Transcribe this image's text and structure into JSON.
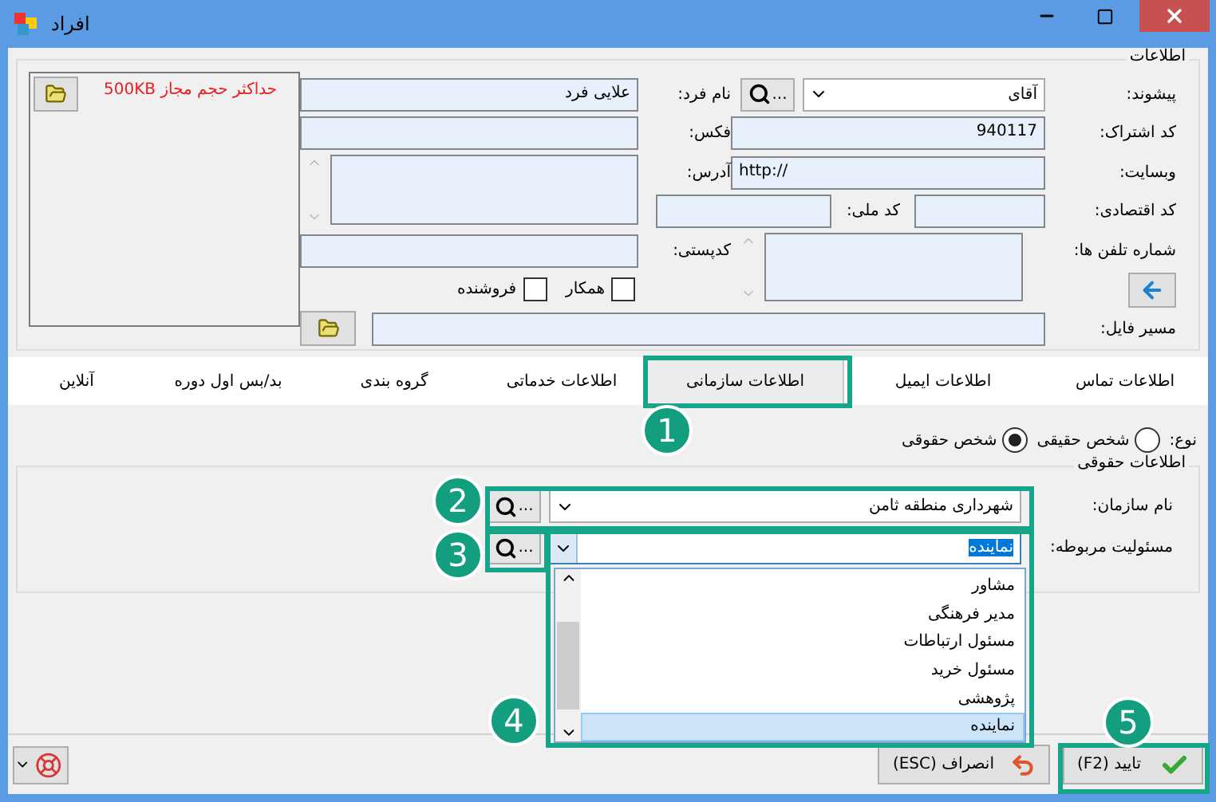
{
  "window": {
    "title": "افراد"
  },
  "info_group": {
    "title": "اطلاعات",
    "image_note": "حداکثر حجم مجاز 500KB",
    "prefix": {
      "label": "پیشوند:",
      "value": "آقای",
      "more": "..."
    },
    "person_name": {
      "label": "نام فرد:",
      "value": "علایی فرد"
    },
    "subscription_code": {
      "label": "کد اشتراک:",
      "value": "940117"
    },
    "fax": {
      "label": "فکس:"
    },
    "website": {
      "label": "وبسایت:",
      "value": "http://"
    },
    "address": {
      "label": "آدرس:"
    },
    "economic_code": {
      "label": "کد اقتصادی:"
    },
    "national_code": {
      "label": "کد ملی:"
    },
    "phones": {
      "label": "شماره تلفن ها:"
    },
    "postal_code": {
      "label": "کدپستی:"
    },
    "checkboxes": [
      {
        "label": "همکار",
        "checked": false
      },
      {
        "label": "فروشنده",
        "checked": false
      }
    ],
    "file_path": {
      "label": "مسیر فایل:"
    }
  },
  "tabs": [
    {
      "label": "اطلاعات تماس",
      "selected": false
    },
    {
      "label": "اطلاعات ایمیل",
      "selected": false
    },
    {
      "label": "اطلاعات سازمانی",
      "selected": true
    },
    {
      "label": "اطلاعات خدماتی",
      "selected": false
    },
    {
      "label": "گروه بندی",
      "selected": false
    },
    {
      "label": "بد/بس اول دوره",
      "selected": false
    },
    {
      "label": "آنلاین",
      "selected": false
    }
  ],
  "type_row": {
    "label": "نوع:",
    "options": [
      {
        "label": "شخص حقیقی",
        "selected": false
      },
      {
        "label": "شخص حقوقی",
        "selected": true
      }
    ]
  },
  "legal_group": {
    "title": "اطلاعات حقوقی",
    "organization": {
      "label": "نام سازمان:",
      "value": "شهرداری منطقه ثامن",
      "more": "..."
    },
    "responsibility": {
      "label": "مسئولیت مربوطه:",
      "value": "نماینده",
      "more": "..."
    },
    "dropdown": [
      {
        "label": "مشاور",
        "selected": false
      },
      {
        "label": "مدیر فرهنگی",
        "selected": false
      },
      {
        "label": "مسئول ارتباطات",
        "selected": false
      },
      {
        "label": "مسئول خرید",
        "selected": false
      },
      {
        "label": "پژوهشی",
        "selected": false
      },
      {
        "label": "نماینده",
        "selected": true
      }
    ]
  },
  "buttons": [
    {
      "kind": "ok",
      "label": "تایید (F2)"
    },
    {
      "kind": "cancel",
      "label": "انصراف (ESC)"
    }
  ],
  "annotations": [
    {
      "number": "1"
    },
    {
      "number": "2"
    },
    {
      "number": "3"
    },
    {
      "number": "4"
    },
    {
      "number": "5"
    }
  ]
}
